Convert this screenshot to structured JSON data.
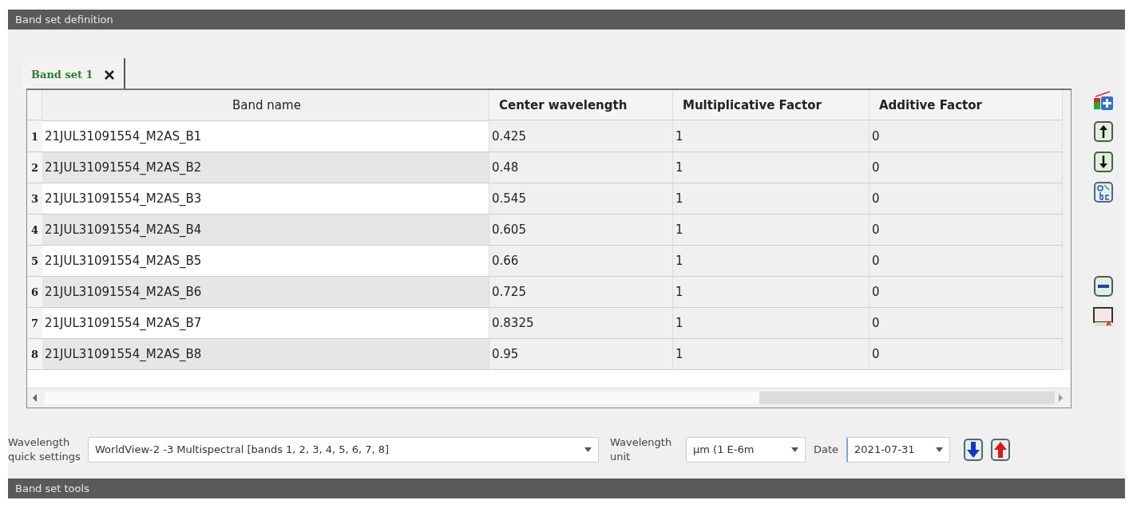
{
  "header": {
    "title": "Band set definition"
  },
  "tabs": [
    {
      "label": "Band set 1",
      "selected": true
    }
  ],
  "table": {
    "columns": [
      "Band name",
      "Center wavelength",
      "Multiplicative Factor",
      "Additive Factor"
    ],
    "rows": [
      {
        "number": "1",
        "cells": [
          "21JUL31091554_M2AS_B1",
          "0.425",
          "1",
          "0"
        ]
      },
      {
        "number": "2",
        "cells": [
          "21JUL31091554_M2AS_B2",
          "0.48",
          "1",
          "0"
        ]
      },
      {
        "number": "3",
        "cells": [
          "21JUL31091554_M2AS_B3",
          "0.545",
          "1",
          "0"
        ]
      },
      {
        "number": "4",
        "cells": [
          "21JUL31091554_M2AS_B4",
          "0.605",
          "1",
          "0"
        ]
      },
      {
        "number": "5",
        "cells": [
          "21JUL31091554_M2AS_B5",
          "0.66",
          "1",
          "0"
        ]
      },
      {
        "number": "6",
        "cells": [
          "21JUL31091554_M2AS_B6",
          "0.725",
          "1",
          "0"
        ]
      },
      {
        "number": "7",
        "cells": [
          "21JUL31091554_M2AS_B7",
          "0.8325",
          "1",
          "0"
        ]
      },
      {
        "number": "8",
        "cells": [
          "21JUL31091554_M2AS_B8",
          "0.95",
          "1",
          "0"
        ]
      }
    ]
  },
  "settings": {
    "quick_label": "Wavelength quick settings",
    "quick_value": "WorldView-2 -3 Multispectral [bands 1, 2, 3, 4, 5, 6, 7, 8]",
    "unit_label": "Wavelength unit",
    "unit_value": "µm (1 E-6m",
    "date_label": "Date",
    "date_value": "2021-07-31"
  },
  "footer": {
    "title": "Band set tools"
  }
}
